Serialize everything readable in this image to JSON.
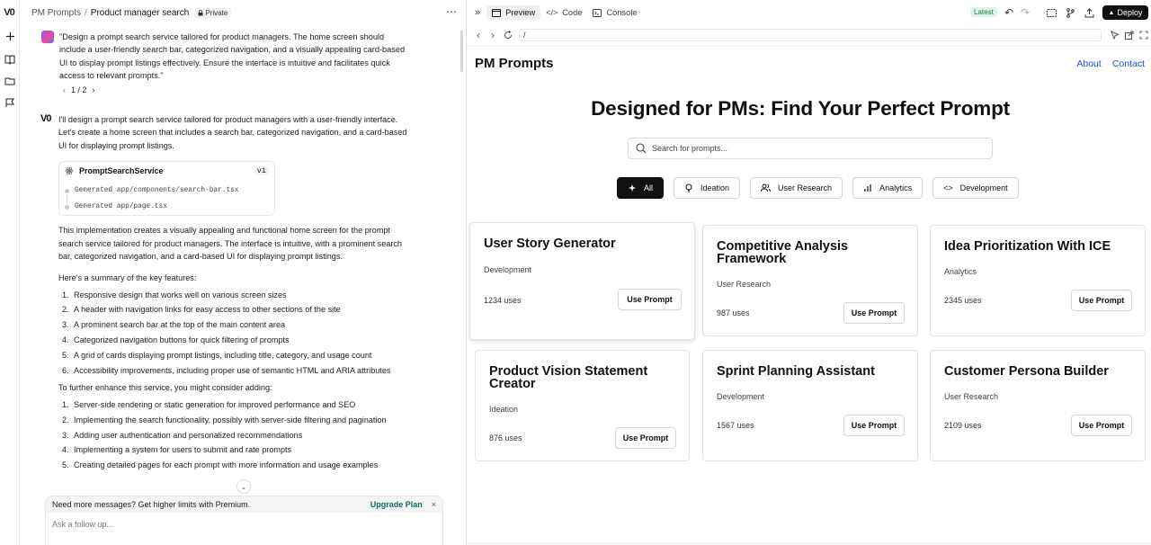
{
  "breadcrumb": {
    "project": "PM Prompts",
    "separator": "/",
    "current": "Product manager search",
    "visibility": "Private"
  },
  "user_message": {
    "text": "\"Design a prompt search service tailored for product managers. The home screen should include a user-friendly search bar, categorized navigation, and a visually appealing card-based UI to display prompt listings effectively. Ensure the interface is intuitive and facilitates quick access to relevant prompts.\"",
    "pager": "1 / 2"
  },
  "assistant": {
    "logo": "V0",
    "intro": "I'll design a prompt search service tailored for product managers with a user-friendly interface. Let's create a home screen that includes a search bar, categorized navigation, and a card-based UI for displaying prompt listings.",
    "version_card": {
      "title": "PromptSearchService",
      "version": "v1",
      "files": [
        "Generated app/components/search-bar.tsx",
        "Generated app/page.tsx"
      ]
    },
    "paragraph": "This implementation creates a visually appealing and functional home screen for the prompt search service tailored for product managers. The interface is intuitive, with a prominent search bar, categorized navigation, and a card-based UI for displaying prompt listings.",
    "summary_heading": "Here's a summary of the key features:",
    "features": [
      "Responsive design that works well on various screen sizes",
      "A header with navigation links for easy access to other sections of the site",
      "A prominent search bar at the top of the main content area",
      "Categorized navigation buttons for quick filtering of prompts",
      "A grid of cards displaying prompt listings, including title, category, and usage count",
      "Accessibility improvements, including proper use of semantic HTML and ARIA attributes"
    ],
    "enhance_heading": "To further enhance this service, you might consider adding:",
    "enhancements": [
      "Server-side rendering or static generation for improved performance and SEO",
      "Implementing the search functionality, possibly with server-side filtering and pagination",
      "Adding user authentication and personalized recommendations",
      "Implementing a system for users to submit and rate prompts",
      "Creating detailed pages for each prompt with more information and usage examples"
    ]
  },
  "upsell": {
    "text": "Need more messages? Get higher limits with Premium.",
    "link": "Upgrade Plan",
    "close": "×"
  },
  "composer": {
    "placeholder": "Ask a follow up..."
  },
  "right_tabs": {
    "preview": "Preview",
    "code": "Code",
    "console": "Console",
    "badge": "Latest",
    "deploy": "Deploy"
  },
  "url": "/",
  "preview": {
    "brand": "PM Prompts",
    "nav": [
      "About",
      "Contact"
    ],
    "hero": "Designed for PMs: Find Your Perfect Prompt",
    "search_placeholder": "Search for prompts...",
    "categories": [
      {
        "label": "All",
        "icon": "sparkles-icon",
        "active": true
      },
      {
        "label": "Ideation",
        "icon": "lightbulb-icon",
        "active": false
      },
      {
        "label": "User Research",
        "icon": "users-icon",
        "active": false
      },
      {
        "label": "Analytics",
        "icon": "bar-chart-icon",
        "active": false
      },
      {
        "label": "Development",
        "icon": "code-icon",
        "active": false
      }
    ],
    "cards": [
      {
        "title": "User Story Generator",
        "category": "Development",
        "uses": "1234 uses",
        "button": "Use Prompt"
      },
      {
        "title": "Competitive Analysis Framework",
        "category": "User Research",
        "uses": "987 uses",
        "button": "Use Prompt"
      },
      {
        "title": "Idea Prioritization With ICE",
        "category": "Analytics",
        "uses": "2345 uses",
        "button": "Use Prompt"
      },
      {
        "title": "Product Vision Statement Creator",
        "category": "Ideation",
        "uses": "876 uses",
        "button": "Use Prompt"
      },
      {
        "title": "Sprint Planning Assistant",
        "category": "Development",
        "uses": "1567 uses",
        "button": "Use Prompt"
      },
      {
        "title": "Customer Persona Builder",
        "category": "User Research",
        "uses": "2109 uses",
        "button": "Use Prompt"
      }
    ]
  },
  "colors": {
    "accent_link": "#1d4ed8",
    "upgrade": "#0f6b5f",
    "latest_bg": "#dff5e8",
    "active_category": "#111111"
  }
}
